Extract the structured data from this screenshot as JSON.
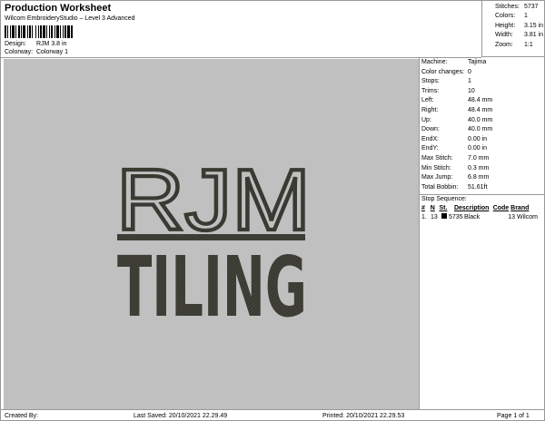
{
  "header": {
    "title": "Production Worksheet",
    "subtitle": "Wilcom EmbroideryStudio – Level 3 Advanced",
    "design_label": "Design:",
    "design_value": "RJM 3.8 in",
    "colorway_label": "Colorway:",
    "colorway_value": "Colorway 1"
  },
  "stats": [
    {
      "label": "Stitches:",
      "value": "5737"
    },
    {
      "label": "Colors:",
      "value": "1"
    },
    {
      "label": "Height:",
      "value": "3.15 in"
    },
    {
      "label": "Width:",
      "value": "3.81 in"
    },
    {
      "label": "Zoom:",
      "value": "1:1"
    }
  ],
  "machine_info": [
    {
      "label": "Machine:",
      "value": "Tajima"
    },
    {
      "label": "Color changes:",
      "value": "0"
    },
    {
      "label": "Stops:",
      "value": "1"
    },
    {
      "label": "Trims:",
      "value": "10"
    },
    {
      "label": "Left:",
      "value": "48.4 mm"
    },
    {
      "label": "Right:",
      "value": "48.4 mm"
    },
    {
      "label": "Up:",
      "value": "40.0 mm"
    },
    {
      "label": "Down:",
      "value": "40.0 mm"
    },
    {
      "label": "EndX:",
      "value": "0.00 in"
    },
    {
      "label": "EndY:",
      "value": "0.00 in"
    },
    {
      "label": "Max Stitch:",
      "value": "7.0 mm"
    },
    {
      "label": "Min Stitch:",
      "value": "0.3 mm"
    },
    {
      "label": "Max Jump:",
      "value": "6.8 mm"
    },
    {
      "label": "Total Bobbin:",
      "value": "51.61ft"
    }
  ],
  "stop_sequence": {
    "title": "Stop Sequence:",
    "columns": [
      "#",
      "N",
      "St.",
      "Description",
      "Code",
      "Brand"
    ],
    "rows": [
      {
        "num": "1.",
        "n": "13",
        "st": "5735",
        "description": "Black",
        "code": "13",
        "brand": "Wilcom",
        "color": "#000000"
      }
    ]
  },
  "design": {
    "line1": "RJM",
    "line2": "TILING",
    "thread_color": "#3a3a33",
    "background_color": "#c0c0c0"
  },
  "footer": {
    "created_by": "Created By:",
    "last_saved": "Last Saved: 20/10/2021 22.29.49",
    "printed": "Printed: 20/10/2021 22.29.53",
    "page": "Page 1 of 1"
  }
}
